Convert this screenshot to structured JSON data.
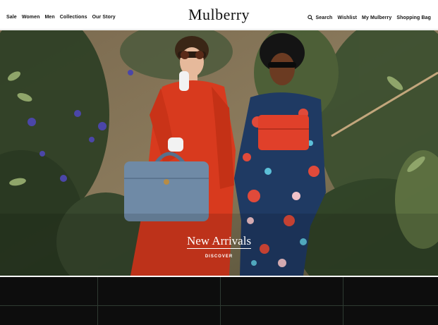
{
  "header": {
    "logo": "Mulberry",
    "nav_left": [
      "Sale",
      "Women",
      "Men",
      "Collections",
      "Our Story"
    ],
    "search_label": "Search",
    "wishlist_label": "Wishlist",
    "account_label": "My Mulberry",
    "bag_label": "Shopping Bag"
  },
  "hero": {
    "headline": "New Arrivals",
    "cta": "DISCOVER"
  },
  "colors": {
    "dress_red": "#d83a1e",
    "bag_blue": "#6f8aa6",
    "foliage": "#3c4a30",
    "tile_dark": "#0d0d0d"
  }
}
